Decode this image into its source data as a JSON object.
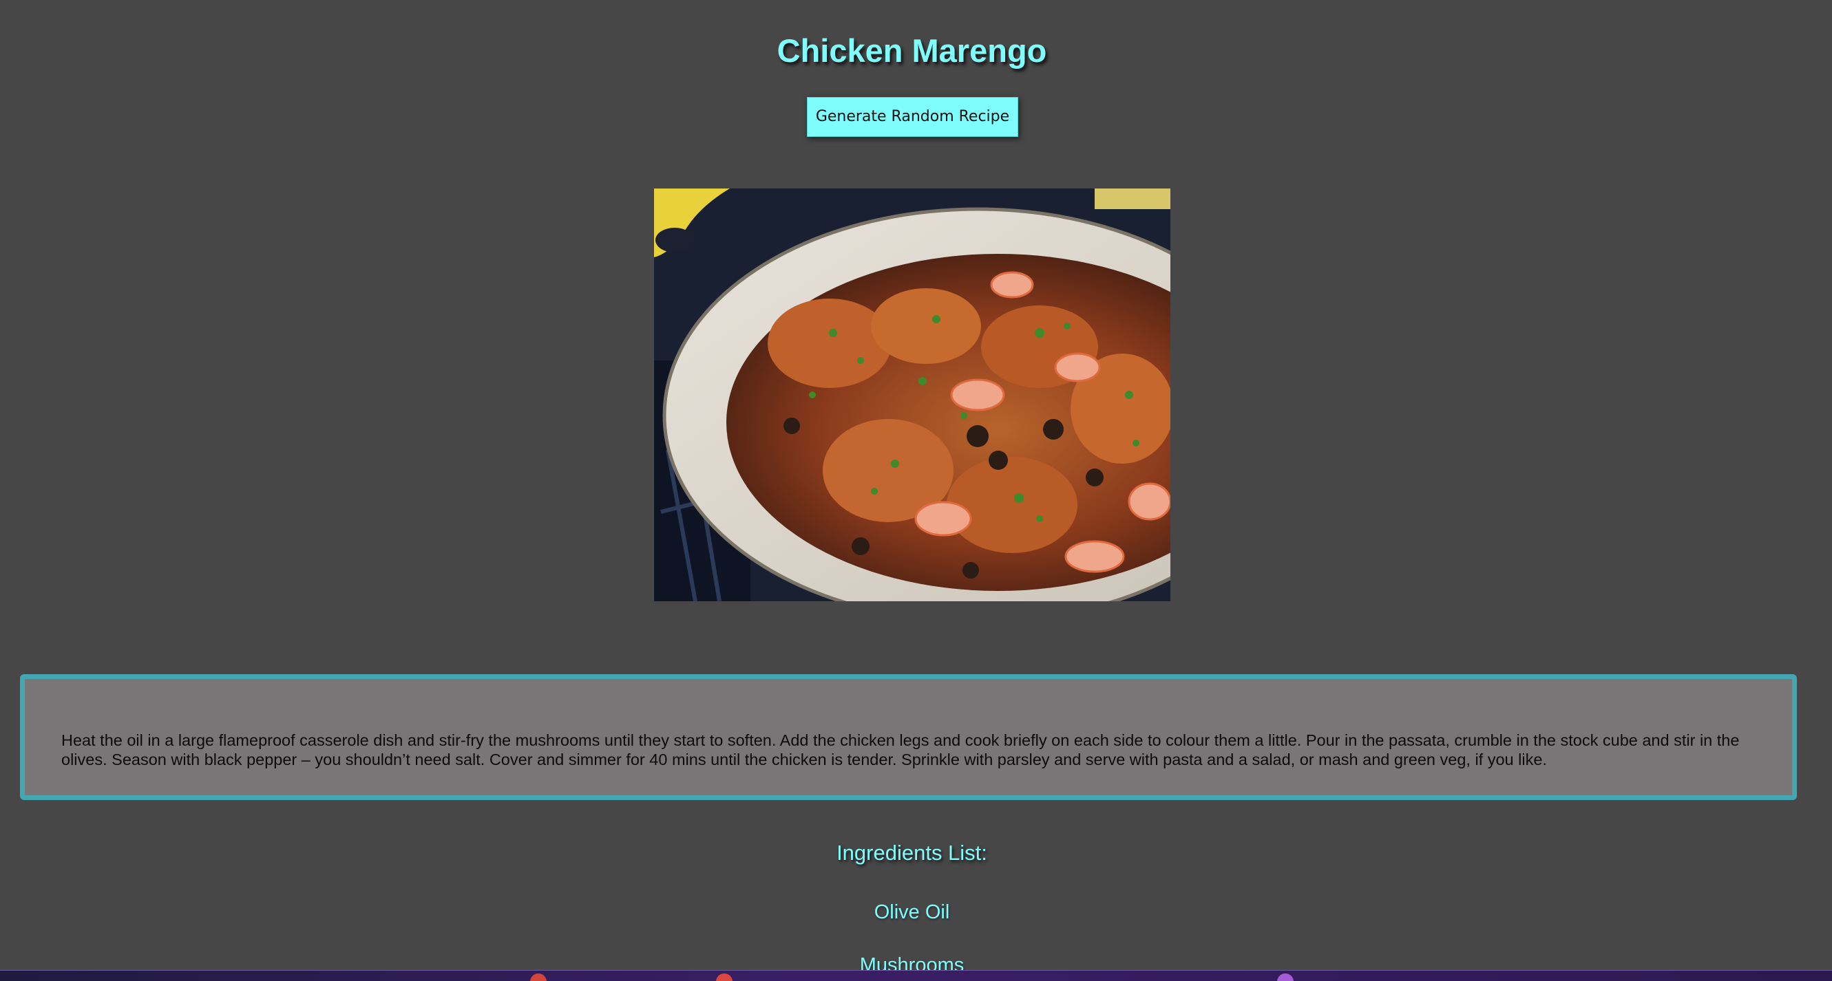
{
  "recipe": {
    "title": "Chicken Marengo",
    "generate_button_label": "Generate Random Recipe",
    "image_alt": "Chicken Marengo",
    "instructions": "Heat the oil in a large flameproof casserole dish and stir-fry the mushrooms until they start to soften. Add the chicken legs and cook briefly on each side to colour them a little.  Pour in the passata, crumble in the stock cube and stir in the olives. Season with black pepper – you shouldn’t need salt. Cover and simmer for 40 mins until the chicken is tender. Sprinkle with parsley and serve with pasta and a salad, or mash and green veg, if you like.",
    "ingredients_heading": "Ingredients List:",
    "ingredients": [
      "Olive Oil",
      "Mushrooms"
    ]
  },
  "colors": {
    "accent": "#7ffcfc",
    "background": "#474747",
    "panel": "#787677",
    "panel_border": "#43a6b0"
  }
}
